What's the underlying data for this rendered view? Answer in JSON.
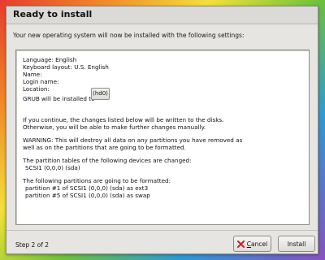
{
  "window": {
    "title": "Ready to install",
    "intro": "Your new operating system will now be installed with the following settings:"
  },
  "summary": {
    "language": "Language: English",
    "keyboard": "Keyboard layout: U.S. English",
    "name": "Name:",
    "login": "Login name:",
    "location": "Location:",
    "grub_prefix": "GRUB will be installed to",
    "grub_target": "(hd0)",
    "continue_1": "If you continue, the changes listed below will be written to the disks.",
    "continue_2": "Otherwise, you will be able to make further changes manually.",
    "warning_1": "WARNING: This will destroy all data on any partitions you have removed as",
    "warning_2": "well as on the partitions that are going to be formatted.",
    "tables_heading": "The partition tables of the following devices are changed:",
    "tables_device": "SCSI1 (0,0,0) (sda)",
    "format_heading": "The following partitions are going to be formatted:",
    "format_1": "partition #1 of SCSI1 (0,0,0) (sda) as ext3",
    "format_2": "partition #5 of SCSI1 (0,0,0) (sda) as swap"
  },
  "footer": {
    "step": "Step 2 of 2",
    "cancel_mnemonic": "C",
    "cancel_rest": "ancel",
    "install": "Install"
  },
  "colors": {
    "cancel_icon": "#cc2222"
  }
}
